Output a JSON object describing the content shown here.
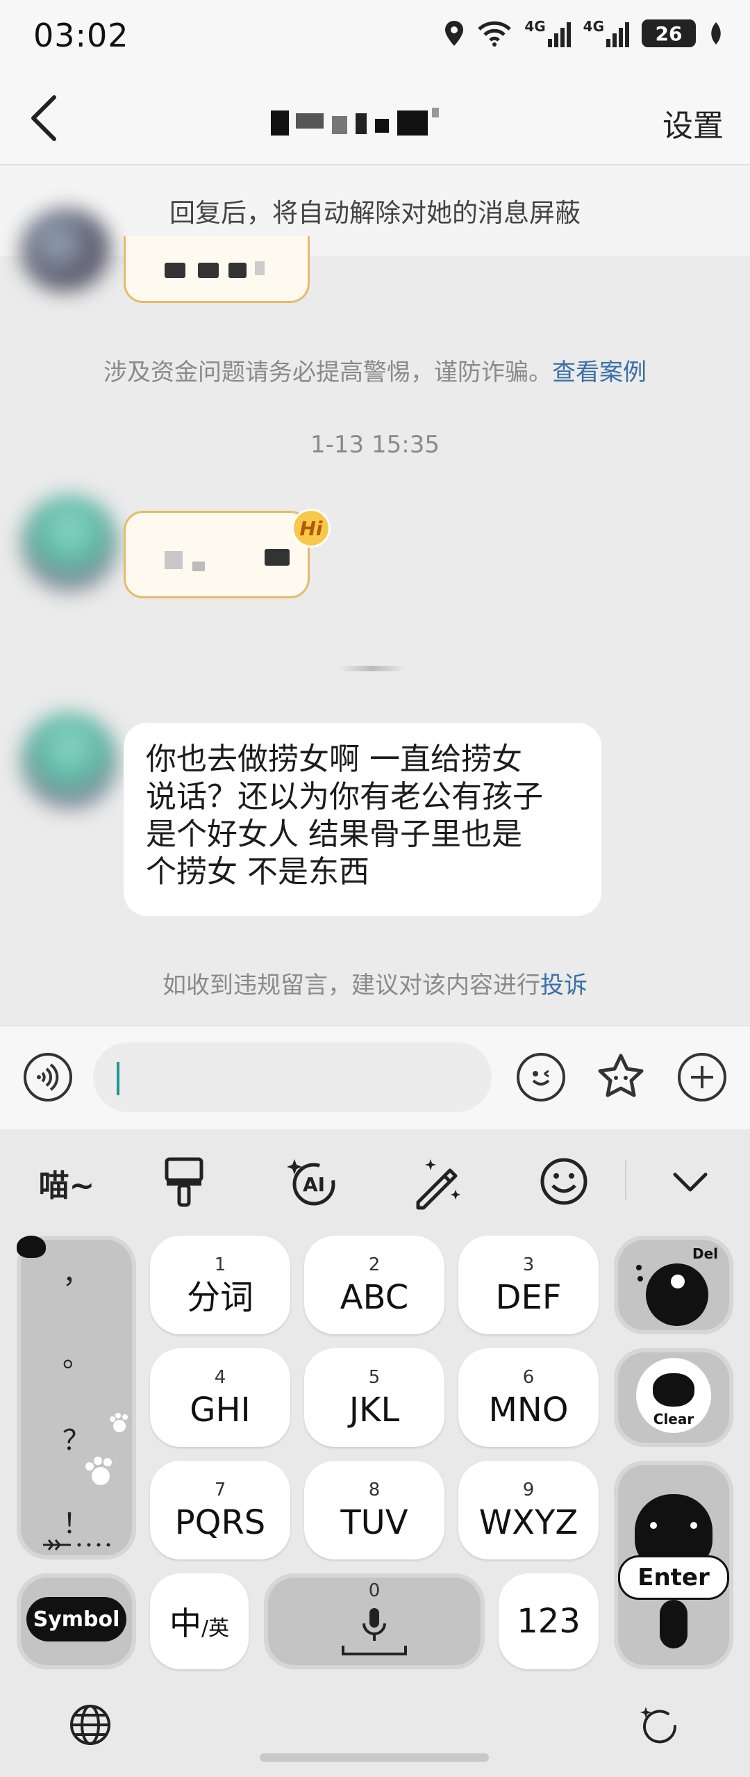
{
  "status_bar": {
    "time": "03:02",
    "network_1": "4G",
    "network_2": "4G",
    "battery": "26",
    "icons": [
      "location-icon",
      "wifi-icon",
      "signal-icon",
      "signal-icon",
      "battery-icon",
      "leaf-icon"
    ]
  },
  "header": {
    "settings_label": "设置",
    "back_icon": "chevron-left-icon"
  },
  "notice": {
    "text": "回复后，将自动解除对她的消息屏蔽"
  },
  "chat": {
    "warning_text": "涉及资金问题请务必提高警惕，谨防诈骗。",
    "warning_link": "查看案例",
    "timestamp": "1-13 15:35",
    "hi_badge": "Hi",
    "message_lines": [
      "你也去做捞女啊 一直给捞女",
      "说话？还以为你有老公有孩子",
      "是个好女人 结果骨子里也是",
      "个捞女 不是东西"
    ],
    "report_text": "如收到违规留言，建议对该内容进行",
    "report_link": "投诉"
  },
  "input_bar": {
    "value": "",
    "icons": [
      "voice-icon",
      "emoji-icon",
      "sticker-icon",
      "plus-icon"
    ]
  },
  "keyboard": {
    "toolbar": {
      "meow_label": "喵~",
      "icons": [
        "paint-brush-icon",
        "ai-icon",
        "magic-pen-icon",
        "smiley-icon",
        "collapse-icon"
      ]
    },
    "punctuation": [
      "，",
      "。",
      "？",
      "！"
    ],
    "keys": [
      {
        "num": "1",
        "label": "分词"
      },
      {
        "num": "2",
        "label": "ABC"
      },
      {
        "num": "3",
        "label": "DEF"
      },
      {
        "num": "4",
        "label": "GHI"
      },
      {
        "num": "5",
        "label": "JKL"
      },
      {
        "num": "6",
        "label": "MNO"
      },
      {
        "num": "7",
        "label": "PQRS"
      },
      {
        "num": "8",
        "label": "TUV"
      },
      {
        "num": "9",
        "label": "WXYZ"
      }
    ],
    "del_label": "Del",
    "clear_label": "Clear",
    "enter_label": "Enter",
    "symbol_label": "Symbol",
    "lang_main": "中",
    "lang_sub": "/英",
    "space_num": "0",
    "num_label": "123",
    "bottom_icons": [
      "globe-icon",
      "refresh-icon"
    ]
  },
  "colors": {
    "accent_link": "#3a6fa6",
    "bubble_border": "#e8b96a",
    "caret": "#1a9a8c",
    "chat_bg": "#ebebeb"
  }
}
